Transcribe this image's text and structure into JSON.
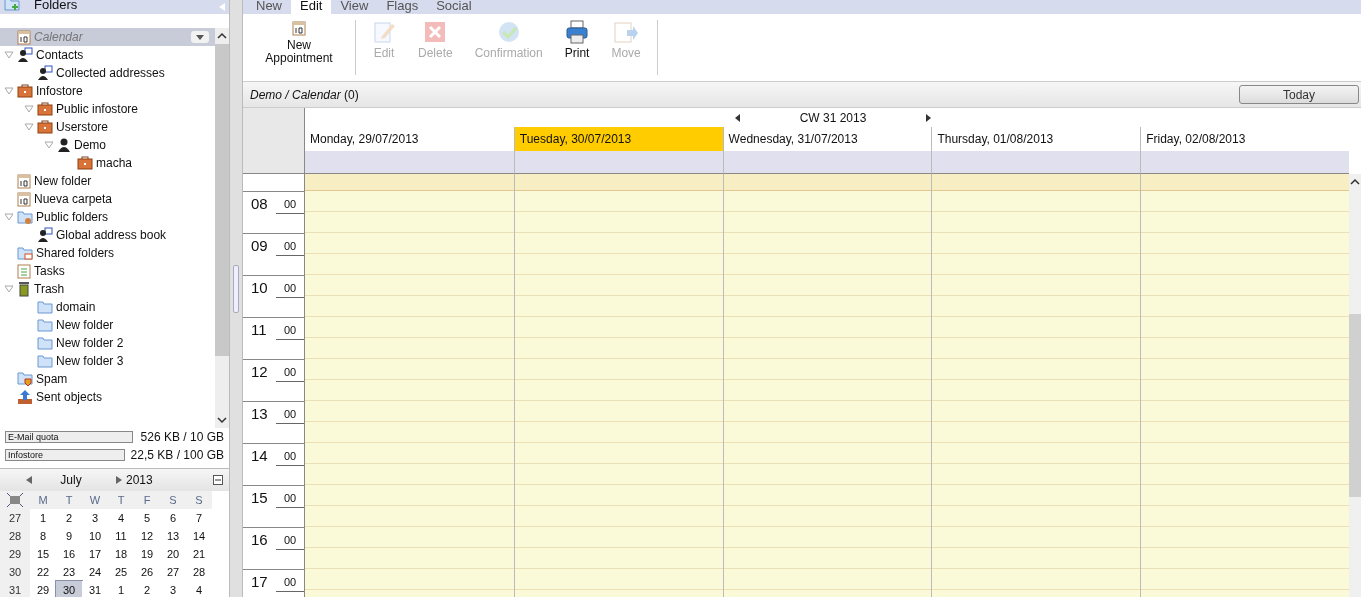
{
  "sidebar": {
    "title": "Folders",
    "tree": [
      {
        "label": "Calendar",
        "kind": "calendar",
        "selected": true
      },
      {
        "label": "Contacts",
        "kind": "contacts",
        "selected": false,
        "expanded": true,
        "children": [
          {
            "label": "Collected addresses",
            "kind": "contacts",
            "selected": false
          }
        ]
      },
      {
        "label": "Infostore",
        "kind": "infostore",
        "selected": false,
        "expanded": true,
        "children": [
          {
            "label": "Public infostore",
            "kind": "infostore",
            "selected": false,
            "expanded": true
          },
          {
            "label": "Userstore",
            "kind": "infostore",
            "selected": false,
            "expanded": true,
            "children": [
              {
                "label": "Demo",
                "kind": "user",
                "selected": false,
                "expanded": true,
                "children": [
                  {
                    "label": "macha",
                    "kind": "infostore",
                    "selected": false
                  }
                ]
              }
            ]
          }
        ]
      },
      {
        "label": "New folder",
        "kind": "calendar",
        "selected": false
      },
      {
        "label": "Nueva carpeta",
        "kind": "calendar",
        "selected": false
      },
      {
        "label": "Public folders",
        "kind": "public",
        "selected": false,
        "expanded": true,
        "children": [
          {
            "label": "Global address book",
            "kind": "contacts",
            "selected": false
          }
        ]
      },
      {
        "label": "Shared folders",
        "kind": "shared",
        "selected": false
      },
      {
        "label": "Tasks",
        "kind": "tasks",
        "selected": false
      },
      {
        "label": "Trash",
        "kind": "trash",
        "selected": false,
        "expanded": true,
        "children": [
          {
            "label": "domain",
            "kind": "folder",
            "selected": false
          },
          {
            "label": "New folder",
            "kind": "folder",
            "selected": false
          },
          {
            "label": "New folder 2",
            "kind": "folder",
            "selected": false
          },
          {
            "label": "New folder 3",
            "kind": "folder",
            "selected": false
          }
        ]
      },
      {
        "label": "Spam",
        "kind": "spam",
        "selected": false
      },
      {
        "label": "Sent objects",
        "kind": "sent",
        "selected": false
      }
    ],
    "quotas": [
      {
        "label": "E-Mail quota",
        "level": 0,
        "reading": "526 KB / 10 GB"
      },
      {
        "label": "Infostore",
        "level": 0,
        "reading": "22,5 KB / 100 GB"
      }
    ]
  },
  "mini_calendar": {
    "month": "July",
    "year": "2013",
    "weekdays": [
      "M",
      "T",
      "W",
      "T",
      "F",
      "S",
      "S"
    ],
    "weeks": [
      {
        "week": "27",
        "days": [
          {
            "day": "1",
            "selected": false
          },
          {
            "day": "2",
            "selected": false
          },
          {
            "day": "3",
            "selected": false
          },
          {
            "day": "4",
            "selected": false
          },
          {
            "day": "5",
            "selected": false
          },
          {
            "day": "6",
            "selected": false
          },
          {
            "day": "7",
            "selected": false
          }
        ]
      },
      {
        "week": "28",
        "days": [
          {
            "day": "8",
            "selected": false
          },
          {
            "day": "9",
            "selected": false
          },
          {
            "day": "10",
            "selected": false
          },
          {
            "day": "11",
            "selected": false
          },
          {
            "day": "12",
            "selected": false
          },
          {
            "day": "13",
            "selected": false
          },
          {
            "day": "14",
            "selected": false
          }
        ]
      },
      {
        "week": "29",
        "days": [
          {
            "day": "15",
            "selected": false
          },
          {
            "day": "16",
            "selected": false
          },
          {
            "day": "17",
            "selected": false
          },
          {
            "day": "18",
            "selected": false
          },
          {
            "day": "19",
            "selected": false
          },
          {
            "day": "20",
            "selected": false
          },
          {
            "day": "21",
            "selected": false
          }
        ]
      },
      {
        "week": "30",
        "days": [
          {
            "day": "22",
            "selected": false
          },
          {
            "day": "23",
            "selected": false
          },
          {
            "day": "24",
            "selected": false
          },
          {
            "day": "25",
            "selected": false
          },
          {
            "day": "26",
            "selected": false
          },
          {
            "day": "27",
            "selected": false
          },
          {
            "day": "28",
            "selected": false
          }
        ]
      },
      {
        "week": "31",
        "days": [
          {
            "day": "29",
            "selected": false
          },
          {
            "day": "30",
            "selected": true
          },
          {
            "day": "31",
            "selected": false
          },
          {
            "day": "1",
            "selected": false
          },
          {
            "day": "2",
            "selected": false
          },
          {
            "day": "3",
            "selected": false
          },
          {
            "day": "4",
            "selected": false
          }
        ]
      }
    ]
  },
  "tabs": [
    {
      "label": "New",
      "selected": false
    },
    {
      "label": "Edit",
      "selected": true
    },
    {
      "label": "View",
      "selected": false
    },
    {
      "label": "Flags",
      "selected": false
    },
    {
      "label": "Social",
      "selected": false
    }
  ],
  "toolbar": {
    "groups": [
      [
        {
          "label": "New Appointment",
          "kind": "calendar",
          "disabled": false
        }
      ],
      [
        {
          "label": "Edit",
          "kind": "edit",
          "disabled": true
        },
        {
          "label": "Delete",
          "kind": "delete",
          "disabled": true
        },
        {
          "label": "Confirmation",
          "kind": "confirm",
          "disabled": true
        },
        {
          "label": "Print",
          "kind": "print",
          "disabled": false
        },
        {
          "label": "Move",
          "kind": "move",
          "disabled": true
        }
      ]
    ]
  },
  "calendar": {
    "path": "Demo / Calendar",
    "count": "(0)",
    "today_button": "Today",
    "week": "CW 31 2013",
    "days": [
      {
        "label": "Monday, 29/07/2013",
        "selected": false
      },
      {
        "label": "Tuesday, 30/07/2013",
        "selected": true
      },
      {
        "label": "Wednesday, 31/07/2013",
        "selected": false
      },
      {
        "label": "Thursday, 01/08/2013",
        "selected": false
      },
      {
        "label": "Friday, 02/08/2013",
        "selected": false
      }
    ],
    "hours": [
      {
        "hour": "08",
        "minute": "00"
      },
      {
        "hour": "09",
        "minute": "00"
      },
      {
        "hour": "10",
        "minute": "00"
      },
      {
        "hour": "11",
        "minute": "00"
      },
      {
        "hour": "12",
        "minute": "00"
      },
      {
        "hour": "13",
        "minute": "00"
      },
      {
        "hour": "14",
        "minute": "00"
      },
      {
        "hour": "15",
        "minute": "00"
      },
      {
        "hour": "16",
        "minute": "00"
      },
      {
        "hour": "17",
        "minute": "00"
      }
    ]
  }
}
